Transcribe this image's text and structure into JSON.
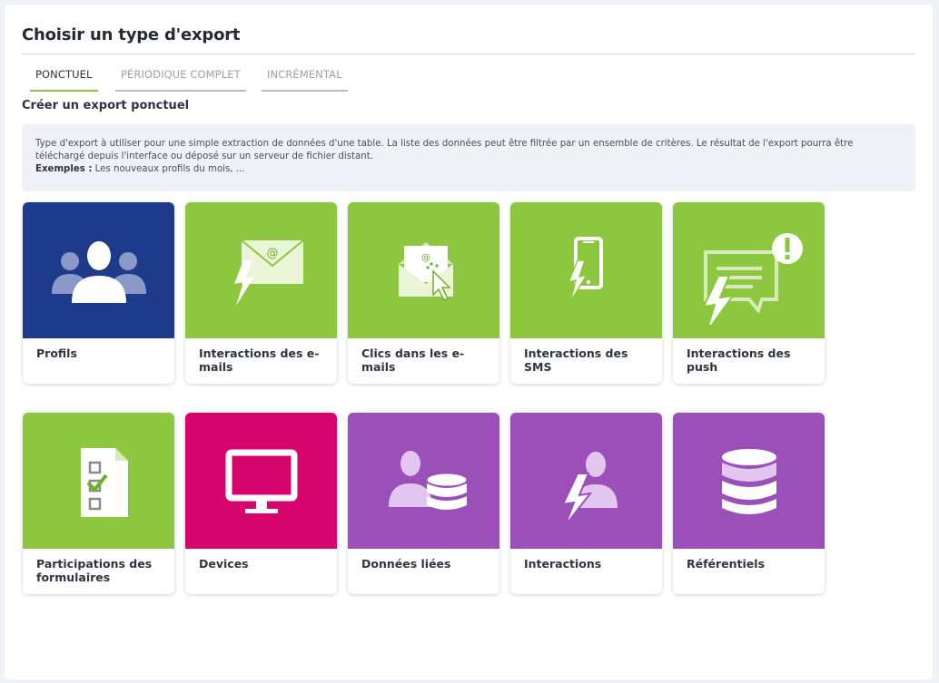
{
  "header": {
    "title": "Choisir un type d'export"
  },
  "tabs": [
    {
      "label": "PONCTUEL",
      "active": true
    },
    {
      "label": "PÉRIODIQUE COMPLET",
      "active": false
    },
    {
      "label": "INCRÉMENTAL",
      "active": false
    }
  ],
  "section": {
    "subtitle": "Créer un export ponctuel"
  },
  "info": {
    "description": "Type d'export à utiliser pour une simple extraction de données d'une table. La liste des données peut être filtrée par un ensemble de critères. Le résultat de l'export pourra être téléchargé depuis l'interface ou déposé sur un serveur de fichier distant.",
    "examples_label": "Exemples :",
    "examples_text": " Les nouveaux profils du mois, ..."
  },
  "colors": {
    "blue": "#1e3a8a",
    "green": "#8dc63f",
    "magenta": "#d6066e",
    "purple": "#9b4fb8"
  },
  "cards": [
    {
      "label": "Profils",
      "icon": "users-icon",
      "color": "#1e3a8a"
    },
    {
      "label": "Interactions des e-mails",
      "icon": "email-interaction-icon",
      "color": "#8dc63f"
    },
    {
      "label": "Clics dans les e-mails",
      "icon": "email-click-icon",
      "color": "#8dc63f"
    },
    {
      "label": "Interactions des SMS",
      "icon": "sms-interaction-icon",
      "color": "#8dc63f"
    },
    {
      "label": "Interactions des push",
      "icon": "push-interaction-icon",
      "color": "#8dc63f"
    },
    {
      "label": "Participations des formulaires",
      "icon": "form-checklist-icon",
      "color": "#8dc63f"
    },
    {
      "label": "Devices",
      "icon": "monitor-icon",
      "color": "#d6066e"
    },
    {
      "label": "Données liées",
      "icon": "user-database-icon",
      "color": "#9b4fb8"
    },
    {
      "label": "Interactions",
      "icon": "user-lightning-icon",
      "color": "#9b4fb8"
    },
    {
      "label": "Référentiels",
      "icon": "database-icon",
      "color": "#9b4fb8"
    }
  ]
}
